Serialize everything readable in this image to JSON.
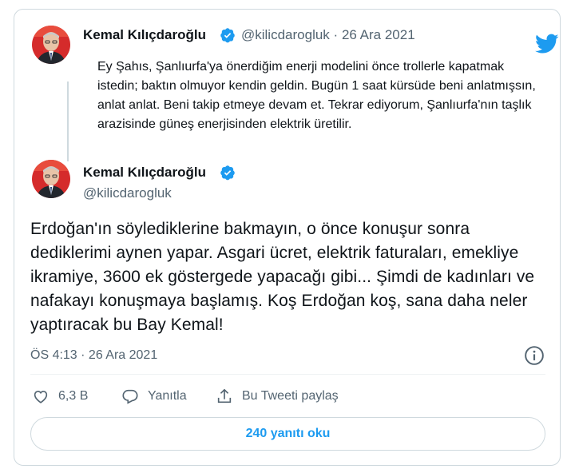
{
  "previous_tweet": {
    "author_name": "Kemal Kılıçdaroğlu",
    "handle": "@kilicdarogluk",
    "separator": "·",
    "date": "26 Ara 2021",
    "text": "Ey Şahıs, Şanlıurfa'ya önerdiğim enerji modelini önce trollerle kapatmak istedin; baktın olmuyor kendin geldin. Bugün 1 saat kürsüde beni anlatmışsın, anlat anlat. Beni takip etmeye devam et. Tekrar ediyorum, Şanlıurfa'nın taşlık arazisinde güneş enerjisinden elektrik üretilir."
  },
  "main_tweet": {
    "author_name": "Kemal Kılıçdaroğlu",
    "handle": "@kilicdarogluk",
    "text": "Erdoğan'ın söylediklerine bakmayın, o önce konuşur sonra dediklerimi aynen yapar. Asgari ücret, elektrik faturaları, emekliye ikramiye, 3600 ek göstergede yapacağı gibi... Şimdi de kadınları ve nafakayı konuşmaya başlamış. Koş Erdoğan koş, sana daha neler yaptıracak bu Bay Kemal!",
    "timestamp": "ÖS 4:13 · 26 Ara 2021"
  },
  "actions": {
    "like_count": "6,3 B",
    "reply_label": "Yanıtla",
    "share_label": "Bu Tweeti paylaş"
  },
  "replies_button": "240 yanıtı oku",
  "colors": {
    "accent": "#1d9bf0",
    "secondary_text": "#536471",
    "border": "#cfd9de"
  },
  "icons": [
    "twitter-bird-icon",
    "verified-badge-icon",
    "info-icon",
    "heart-icon",
    "reply-icon",
    "share-icon"
  ]
}
